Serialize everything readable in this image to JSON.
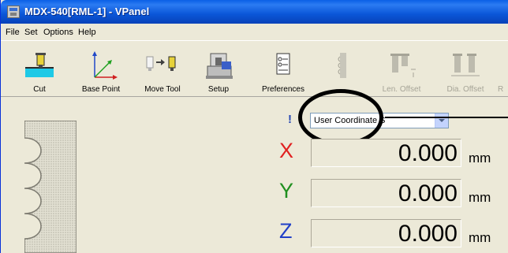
{
  "window": {
    "title": "MDX-540[RML-1] - VPanel"
  },
  "menu": [
    "File",
    "Set",
    "Options",
    "Help"
  ],
  "toolbar": {
    "cut": "Cut",
    "base_point": "Base Point",
    "move_tool": "Move Tool",
    "setup": "Setup",
    "preferences": "Preferences",
    "len_offset": "Len. Offset",
    "dia_offset": "Dia. Offset",
    "last_partial": "R"
  },
  "coord_system": {
    "info_glyph": "!",
    "selected": "User Coordinate S"
  },
  "axes": [
    {
      "label": "X",
      "value": "0.000",
      "unit": "mm",
      "color": "#e02020"
    },
    {
      "label": "Y",
      "value": "0.000",
      "unit": "mm",
      "color": "#1f8f1f"
    },
    {
      "label": "Z",
      "value": "0.000",
      "unit": "mm",
      "color": "#2040c8"
    }
  ],
  "colors": {
    "titlebar": "#0a56d8",
    "panel": "#ece9d8",
    "highlight_ring": "#000000"
  }
}
